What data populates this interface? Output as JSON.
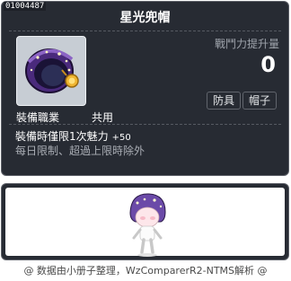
{
  "tooltip": {
    "item_id": "01004487",
    "item_name": "星光兜帽",
    "stat_label": "戰鬥力提升量",
    "stat_value": "0",
    "tags": [
      "防具",
      "帽子"
    ],
    "job_label": "裝備職業",
    "job_value": "共用",
    "desc_line1": "裝備時僅限1次魅力",
    "desc_line1_bonus": "+50",
    "desc_line2": "每日限制、超過上限時除外"
  },
  "footer": {
    "credit": "@ 数据由小册子整理，WzComparerR2-NTMS解析 @"
  },
  "icons": {
    "item": "star-hood-icon",
    "avatar": "character-preview-icon"
  },
  "colors": {
    "panel_bg": "#272b33",
    "panel_border": "#5d6068",
    "hood_purple": "#5a2d8e",
    "coin_gold": "#f0b530"
  }
}
